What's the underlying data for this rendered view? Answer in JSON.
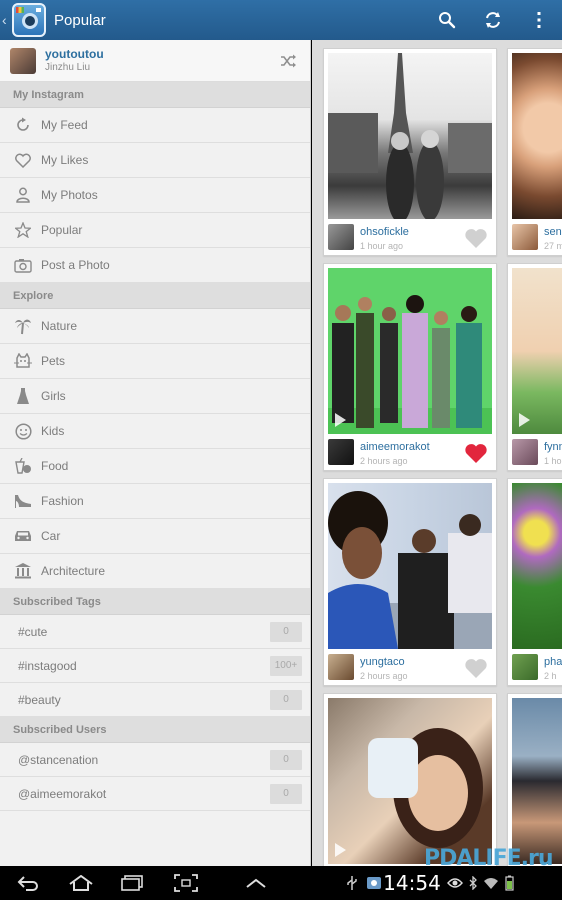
{
  "actionbar": {
    "title": "Popular",
    "actions": [
      {
        "icon": "search-icon"
      },
      {
        "icon": "refresh-icon"
      },
      {
        "icon": "overflow-menu-icon"
      }
    ]
  },
  "sidebar": {
    "profile": {
      "username": "youtoutou",
      "real_name": "Jinzhu Liu"
    },
    "sections": {
      "my_instagram": "My Instagram",
      "explore": "Explore",
      "subscribed_tags": "Subscribed Tags",
      "subscribed_users": "Subscribed Users"
    },
    "my_instagram": [
      {
        "label": "My Feed",
        "icon": "feed-icon"
      },
      {
        "label": "My Likes",
        "icon": "heart-outline-icon"
      },
      {
        "label": "My Photos",
        "icon": "person-icon"
      },
      {
        "label": "Popular",
        "icon": "star-icon"
      },
      {
        "label": "Post a Photo",
        "icon": "camera-icon"
      }
    ],
    "explore": [
      {
        "label": "Nature",
        "icon": "palm-tree-icon"
      },
      {
        "label": "Pets",
        "icon": "cat-icon"
      },
      {
        "label": "Girls",
        "icon": "dress-icon"
      },
      {
        "label": "Kids",
        "icon": "smiley-face-icon"
      },
      {
        "label": "Food",
        "icon": "food-icon"
      },
      {
        "label": "Fashion",
        "icon": "high-heel-icon"
      },
      {
        "label": "Car",
        "icon": "car-icon"
      },
      {
        "label": "Architecture",
        "icon": "building-icon"
      }
    ],
    "tags": [
      {
        "label": "#cute",
        "count": "0"
      },
      {
        "label": "#instagood",
        "count": "100+"
      },
      {
        "label": "#beauty",
        "count": "0"
      }
    ],
    "users": [
      {
        "label": "@stancenation",
        "count": "0"
      },
      {
        "label": "@aimeemorakot",
        "count": "0"
      }
    ]
  },
  "feed": {
    "cards": [
      {
        "user": "ohsofickle",
        "time": "1 hour ago",
        "liked": false
      },
      {
        "user": "send",
        "time": "27 m",
        "liked": false
      },
      {
        "user": "aimeemorakot",
        "time": "2 hours ago",
        "liked": true
      },
      {
        "user": "fynn",
        "time": "1 hou",
        "liked": false
      },
      {
        "user": "yungtaco",
        "time": "2 hours ago",
        "liked": false
      },
      {
        "user": "pha",
        "time": "2 h",
        "liked": false
      }
    ]
  },
  "navbar": {
    "time": "14:54",
    "watermark": "PDALIFE.ru"
  },
  "colors": {
    "actionbar": "#2b6699",
    "link": "#2d6f9f",
    "liked_heart": "#e2263d",
    "unliked_heart": "#d0d0d0"
  }
}
